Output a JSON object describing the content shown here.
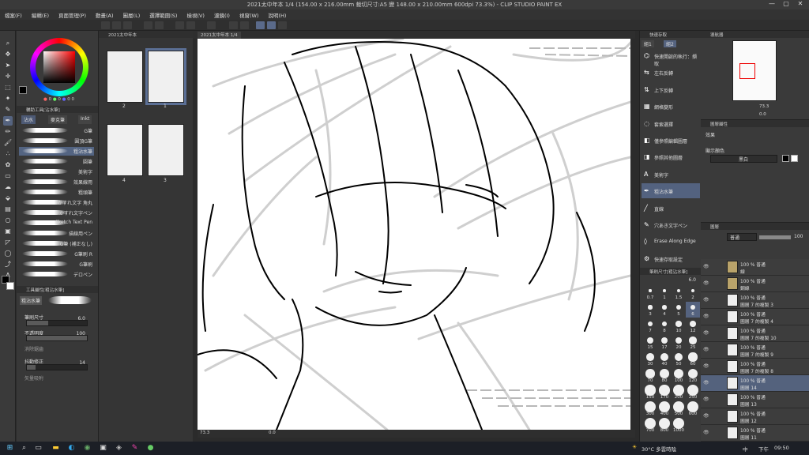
{
  "window": {
    "title": "2021太中年本 1/4 (154.00 x 216.00mm 裁切尺寸:A5 變 148.00 x 210.00mm 600dpi 73.3%) - CLIP STUDIO PAINT EX",
    "minimize": "—",
    "maximize": "▢",
    "close": "✕"
  },
  "menu": [
    "檔案(F)",
    "編輯(E)",
    "頁面管理(P)",
    "動畫(A)",
    "圖層(L)",
    "選擇範圍(S)",
    "檢視(V)",
    "濾鏡(I)",
    "視窗(W)",
    "說明(H)"
  ],
  "color": {
    "accent": "#55637f",
    "values": [
      "0",
      "0",
      "0",
      "0"
    ]
  },
  "subtool": {
    "header": "輔助工具[沾水筆]",
    "tabs": [
      "沾水",
      "麥克筆",
      "Inkt"
    ],
    "brushes": [
      "G筆",
      "圓頂G筆",
      "粗沾水筆",
      "圓筆",
      "美術字",
      "效果線用",
      "粗頭筆",
      "かすれ文字 角丸",
      "かすれ文字ペン",
      "Sketch Text Pen",
      "描線用ペン",
      "G筆 (補正なし)",
      "G筆刷 R",
      "G筆刷",
      "デロペン"
    ],
    "selected_index": 2
  },
  "toolprop": {
    "header": "工具屬性[粗沾水筆]",
    "brush_name": "粗沾水筆",
    "size_label": "筆刷尺寸",
    "size_value": "6.0",
    "size_level": 0.35,
    "opacity_label": "不透明度",
    "opacity_value": "100",
    "opacity_level": 1.0,
    "antialias_label": "消除鋸齒",
    "stabilize_label": "抖動修正",
    "stabilize_value": "14",
    "stabilize_level": 0.14,
    "vector_label": "矢量吸附"
  },
  "pages": {
    "header": "2021太中年本",
    "items": [
      {
        "num": "2",
        "selected": false
      },
      {
        "num": "1",
        "selected": true
      },
      {
        "num": "4",
        "selected": false
      },
      {
        "num": "3",
        "selected": false
      }
    ]
  },
  "canvas_tab": "2021太中年本 1/4",
  "statusbar": {
    "zoom": "73.3",
    "angle": "0.0"
  },
  "quick_access": {
    "header": "快速存取",
    "tabs": [
      "組1",
      "組2"
    ],
    "items": [
      "快速開啟的執行：擷取",
      "左右反轉",
      "上下反轉",
      "網格變形",
      "套索選擇",
      "僅參照編輯圖層",
      "參照其他圖層",
      "美術字",
      "粗沾水筆",
      "直線",
      "穴あき文字ペン",
      "Erase Along Edge",
      "快速存取設定"
    ],
    "selected_index": 8
  },
  "brush_size": {
    "header": "筆刷尺寸[粗沾水筆]",
    "current": "6.0",
    "sizes": [
      "0.7",
      "1",
      "1.5",
      "2",
      "3",
      "4",
      "5",
      "6",
      "7",
      "8",
      "10",
      "12",
      "15",
      "17",
      "20",
      "25",
      "30",
      "40",
      "50",
      "60",
      "70",
      "80",
      "100",
      "120",
      "150",
      "170",
      "200",
      "250",
      "300",
      "400",
      "500",
      "600",
      "700",
      "800",
      "1000"
    ],
    "selected_index": 7
  },
  "navigator": {
    "header": "導航器",
    "zoom": "73.3",
    "angle": "0.0"
  },
  "layer_property": {
    "header": "圖層屬性",
    "effect_label": "效果",
    "display_color_label": "顯示顏色",
    "display_color_value": "黑白"
  },
  "layers": {
    "header": "圖層",
    "blend_mode": "普通",
    "opacity": "100",
    "items": [
      {
        "line1": "100 % 普通",
        "line2": "線",
        "kind": "folder"
      },
      {
        "line1": "100 % 普通",
        "line2": "鋼線",
        "kind": "folder"
      },
      {
        "line1": "100 % 普通",
        "line2": "圖層 7 的複製 3",
        "kind": "layer"
      },
      {
        "line1": "100 % 普通",
        "line2": "圖層 7 的複製 4",
        "kind": "layer"
      },
      {
        "line1": "100 % 普通",
        "line2": "圖層 7 的複製 10",
        "kind": "layer"
      },
      {
        "line1": "100 % 普通",
        "line2": "圖層 7 的複製 9",
        "kind": "layer"
      },
      {
        "line1": "100 % 普通",
        "line2": "圖層 7 的複製 8",
        "kind": "layer"
      },
      {
        "line1": "100 % 普通",
        "line2": "圖層 14",
        "kind": "layer"
      },
      {
        "line1": "100 % 普通",
        "line2": "圖層 13",
        "kind": "layer"
      },
      {
        "line1": "100 % 普通",
        "line2": "圖層 12",
        "kind": "layer"
      },
      {
        "line1": "100 % 普通",
        "line2": "圖層 11",
        "kind": "layer"
      }
    ],
    "selected_index": 7
  },
  "taskbar": {
    "weather": "30°C 多雲時陰",
    "time": "09:50",
    "ampm": "下午",
    "ime": "中"
  }
}
